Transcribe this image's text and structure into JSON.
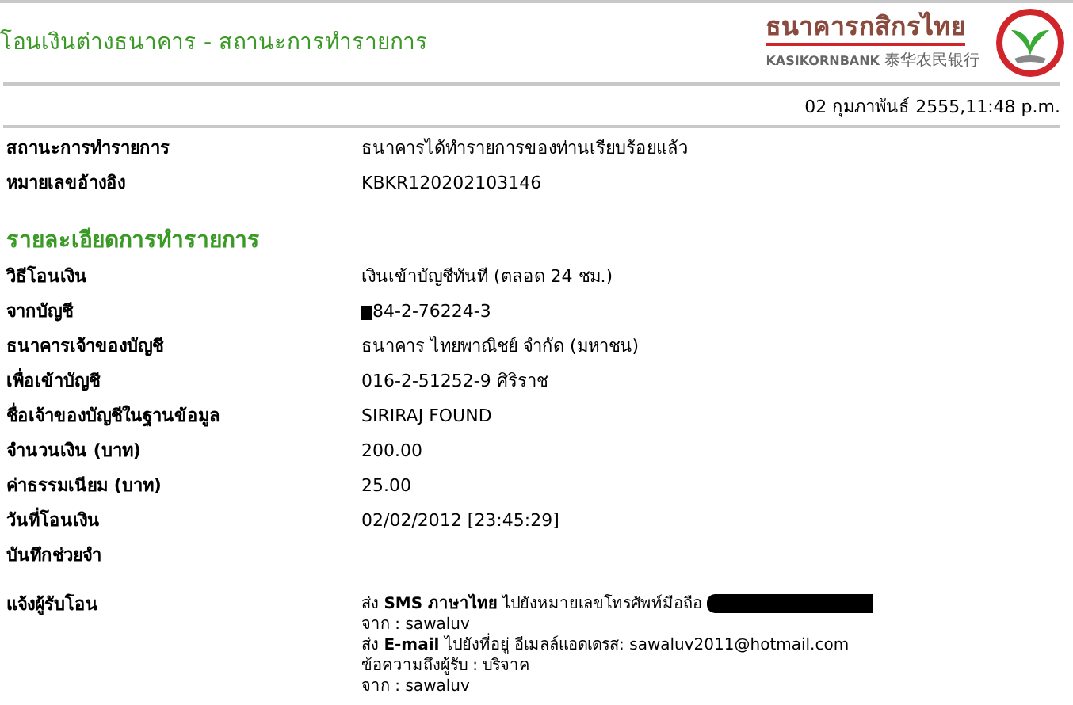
{
  "page_title": "โอนเงินต่างธนาคาร - สถานะการทำรายการ",
  "logo": {
    "thai_name": "ธนาคารกสิกรไทย",
    "english_name": "KASIKORNBANK",
    "chinese_name": "泰华农民银行"
  },
  "timestamp": "02 กุมภาพันธ์ 2555,11:48 p.m.",
  "summary": [
    {
      "label": "สถานะการทำรายการ",
      "value": "ธนาคารได้ทำรายการของท่านเรียบร้อยแล้ว"
    },
    {
      "label": "หมายเลขอ้างอิง",
      "value": "KBKR120202103146"
    }
  ],
  "details_heading": "รายละเอียดการทำรายการ",
  "details": [
    {
      "label": "วิธีโอนเงิน",
      "value": "เงินเข้าบัญชีทันที (ตลอด 24 ชม.)",
      "redacted": false
    },
    {
      "label": "จากบัญชี",
      "value": "84-2-76224-3",
      "redacted": true
    },
    {
      "label": "ธนาคารเจ้าของบัญชี",
      "value": "ธนาคาร ไทยพาณิชย์ จำกัด (มหาชน)",
      "redacted": false
    },
    {
      "label": "เพื่อเข้าบัญชี",
      "value": "016-2-51252-9 ศิริราช",
      "redacted": false
    },
    {
      "label": "ชื่อเจ้าของบัญชีในฐานข้อมูล",
      "value": "SIRIRAJ FOUND",
      "redacted": false
    },
    {
      "label": "จำนวนเงิน (บาท)",
      "value": "200.00",
      "redacted": false
    },
    {
      "label": "ค่าธรรมเนียม (บาท)",
      "value": "25.00",
      "redacted": false
    },
    {
      "label": "วันที่โอนเงิน",
      "value": "02/02/2012 [23:45:29]",
      "redacted": false
    },
    {
      "label": "บันทึกช่วยจำ",
      "redacted": false
    }
  ],
  "notify": {
    "label": "แจ้งผู้รับโอน",
    "lines": [
      {
        "text": "ส่ง **SMS ภาษาไทย** ไปยังหมายเลขโทรศัพท์มือถือ",
        "redacted": true
      },
      {
        "text": "จาก : sawaluv",
        "redacted": false
      },
      {
        "text": "ส่ง **E-mail** ไปยังที่อยู่ อีเมลล์แอดเดรส: sawaluv2011@hotmail.com",
        "redacted": false
      },
      {
        "text": "ข้อความถึงผู้รับ : บริจาค",
        "redacted": false
      },
      {
        "text": "จาก : sawaluv",
        "redacted": false
      }
    ]
  }
}
